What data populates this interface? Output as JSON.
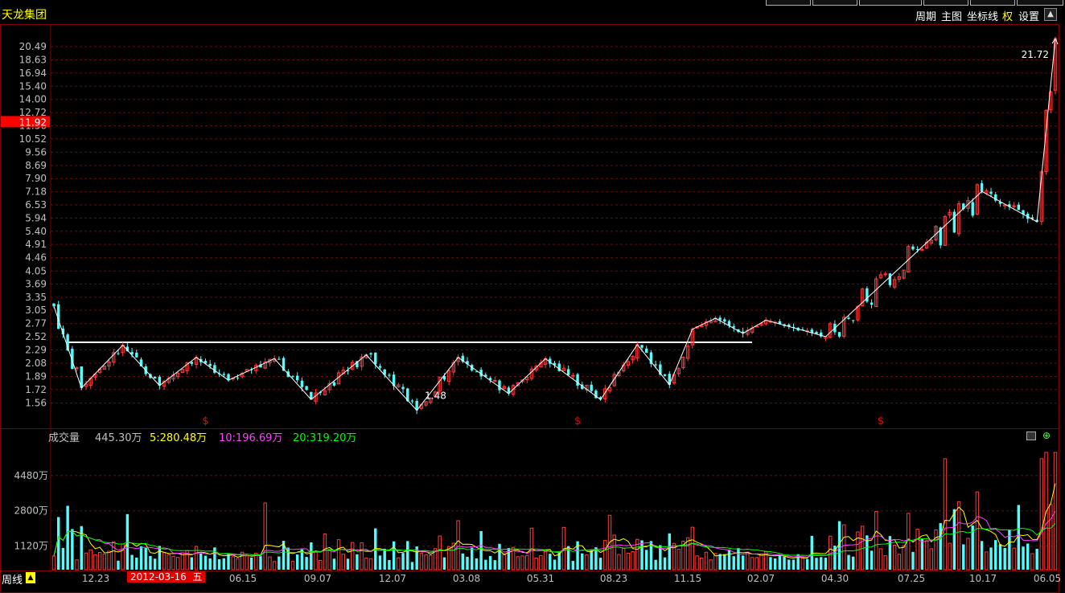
{
  "stock_name": "天龙集团",
  "menu": {
    "period": "周期",
    "main_chart": "主图",
    "axis": "坐标线",
    "rights": "权",
    "settings": "设置"
  },
  "colors": {
    "up": "#ff3b3b",
    "down": "#54fcfc",
    "ma5": "#ffff00",
    "ma10": "#ff40ff",
    "ma20": "#00ff00",
    "zigzag": "#ffffff",
    "grid": "#800000",
    "axis_text": "#c0c0c0"
  },
  "volume_header": {
    "label": "成交量",
    "value": "445.30万",
    "ma5": "5:280.48万",
    "ma10": "10:196.69万",
    "ma20": "20:319.20万"
  },
  "bottom": {
    "period_tab": "周线",
    "period_marker": "▲",
    "selected_date": "2012-03-16",
    "selected_weekday": "五"
  },
  "chart_data": [
    {
      "type": "candlestick",
      "title": "天龙集团",
      "price_ticks": [
        "20.49",
        "18.63",
        "16.94",
        "15.40",
        "14.00",
        "12.72",
        "11.56",
        "10.52",
        "9.56",
        "8.69",
        "7.90",
        "7.18",
        "6.53",
        "5.94",
        "5.40",
        "4.91",
        "4.46",
        "4.05",
        "3.69",
        "3.35",
        "3.05",
        "2.77",
        "2.52",
        "2.29",
        "2.08",
        "1.89",
        "1.72",
        "1.56"
      ],
      "current_price_label": "11.92",
      "scale": "log",
      "ylim": [
        1.46,
        22.5
      ],
      "annotations": [
        {
          "text": "1.48",
          "type": "low"
        },
        {
          "text": "21.72",
          "type": "high"
        }
      ],
      "dividend_markers": [
        "$",
        "$",
        "$"
      ],
      "x_ticks": [
        "12.23",
        "06.15",
        "09.07",
        "12.07",
        "03.08",
        "05.31",
        "08.23",
        "11.15",
        "02.07",
        "04.30",
        "07.25",
        "10.17",
        "06.05"
      ],
      "zigzag_prices": [
        3.14,
        1.74,
        2.37,
        1.77,
        2.17,
        1.84,
        2.15,
        1.6,
        2.21,
        1.48,
        2.17,
        1.67,
        2.15,
        1.6,
        2.38,
        1.78,
        2.66,
        2.88,
        2.58,
        2.84,
        2.52,
        7.2,
        5.78,
        21.72
      ],
      "neckline": 2.42,
      "grid": true
    },
    {
      "type": "bar",
      "title": "成交量",
      "unit": "万",
      "y_ticks": [
        "4480万",
        "2800万",
        "1120万"
      ],
      "ylim": [
        0,
        6000
      ],
      "series": [
        {
          "name": "成交量"
        },
        {
          "name": "5"
        },
        {
          "name": "10"
        },
        {
          "name": "20"
        }
      ],
      "grid": true
    }
  ]
}
